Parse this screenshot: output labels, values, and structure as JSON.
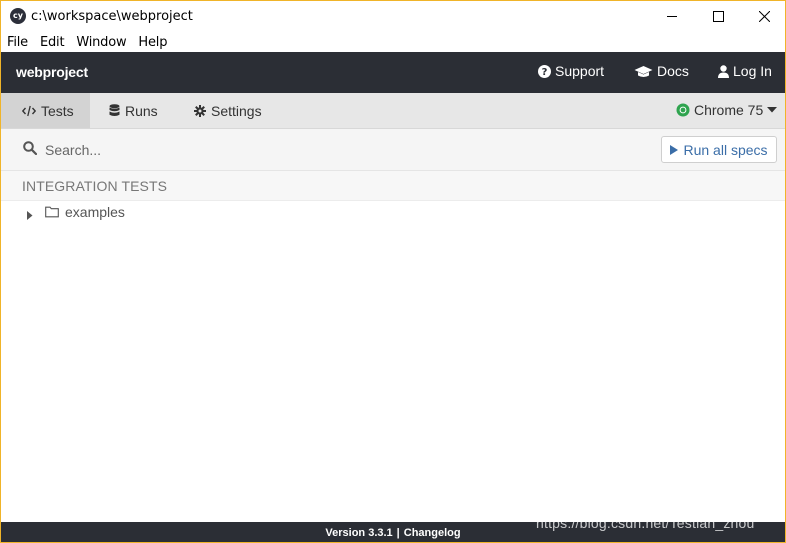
{
  "window": {
    "title": "c:\\workspace\\webproject",
    "app_icon_text": "cy",
    "controls": {
      "minimize": "minimize-icon",
      "maximize": "maximize-icon",
      "close": "close-icon"
    }
  },
  "menubar": {
    "items": [
      "File",
      "Edit",
      "Window",
      "Help"
    ]
  },
  "topnav": {
    "project_name": "webproject",
    "support_label": "Support",
    "docs_label": "Docs",
    "login_label": "Log In"
  },
  "tabs": [
    {
      "label": "Tests",
      "icon": "code-icon",
      "active": true
    },
    {
      "label": "Runs",
      "icon": "database-icon",
      "active": false
    },
    {
      "label": "Settings",
      "icon": "gear-icon",
      "active": false
    }
  ],
  "browser": {
    "label": "Chrome 75",
    "icon": "chrome-icon"
  },
  "search": {
    "placeholder": "Search..."
  },
  "run_all_label": "Run all specs",
  "specs": {
    "section_title": "INTEGRATION TESTS",
    "folders": [
      {
        "label": "examples",
        "expanded": false
      }
    ]
  },
  "footer": {
    "version": "Version 3.3.1",
    "separator": "|",
    "changelog": "Changelog"
  },
  "watermark": "https://blog.csdn.net/Testian_zhou",
  "colors": {
    "nav_background": "#2b2e35",
    "accent_link": "#3b6ea8",
    "chrome_green": "#2fa44f",
    "window_border": "#f0b429"
  }
}
